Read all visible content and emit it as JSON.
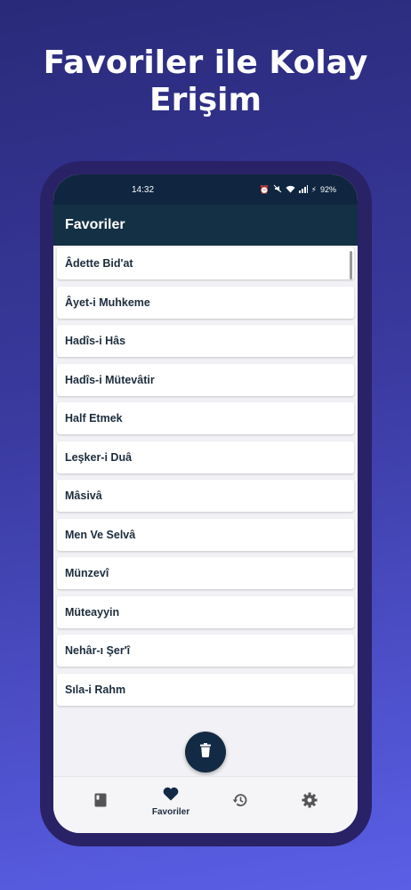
{
  "promo": {
    "title_line1": "Favoriler ile Kolay",
    "title_line2": "Erişim"
  },
  "status_bar": {
    "time": "14:32",
    "battery": "92%"
  },
  "app_bar": {
    "title": "Favoriler"
  },
  "favorites": [
    "Âdette Bid'at",
    "Âyet-i Muhkeme",
    "Hadîs-i Hâs",
    "Hadîs-i Mütevâtir",
    "Half Etmek",
    "Leşker-i Duâ",
    "Mâsivâ",
    "Men Ve Selvâ",
    "Münzevî",
    "Müteayyin",
    "Nehâr-ı Şer'î",
    "Sıla-i Rahm"
  ],
  "bottom_nav": {
    "active_label": "Favoriler",
    "icons": [
      "book-icon",
      "heart-icon",
      "history-icon",
      "gear-icon"
    ]
  },
  "colors": {
    "app_bar": "#143044",
    "status_bar": "#0f2540",
    "fab": "#132a45",
    "background_top": "#2a2a7a",
    "background_bottom": "#5a5fe6"
  }
}
